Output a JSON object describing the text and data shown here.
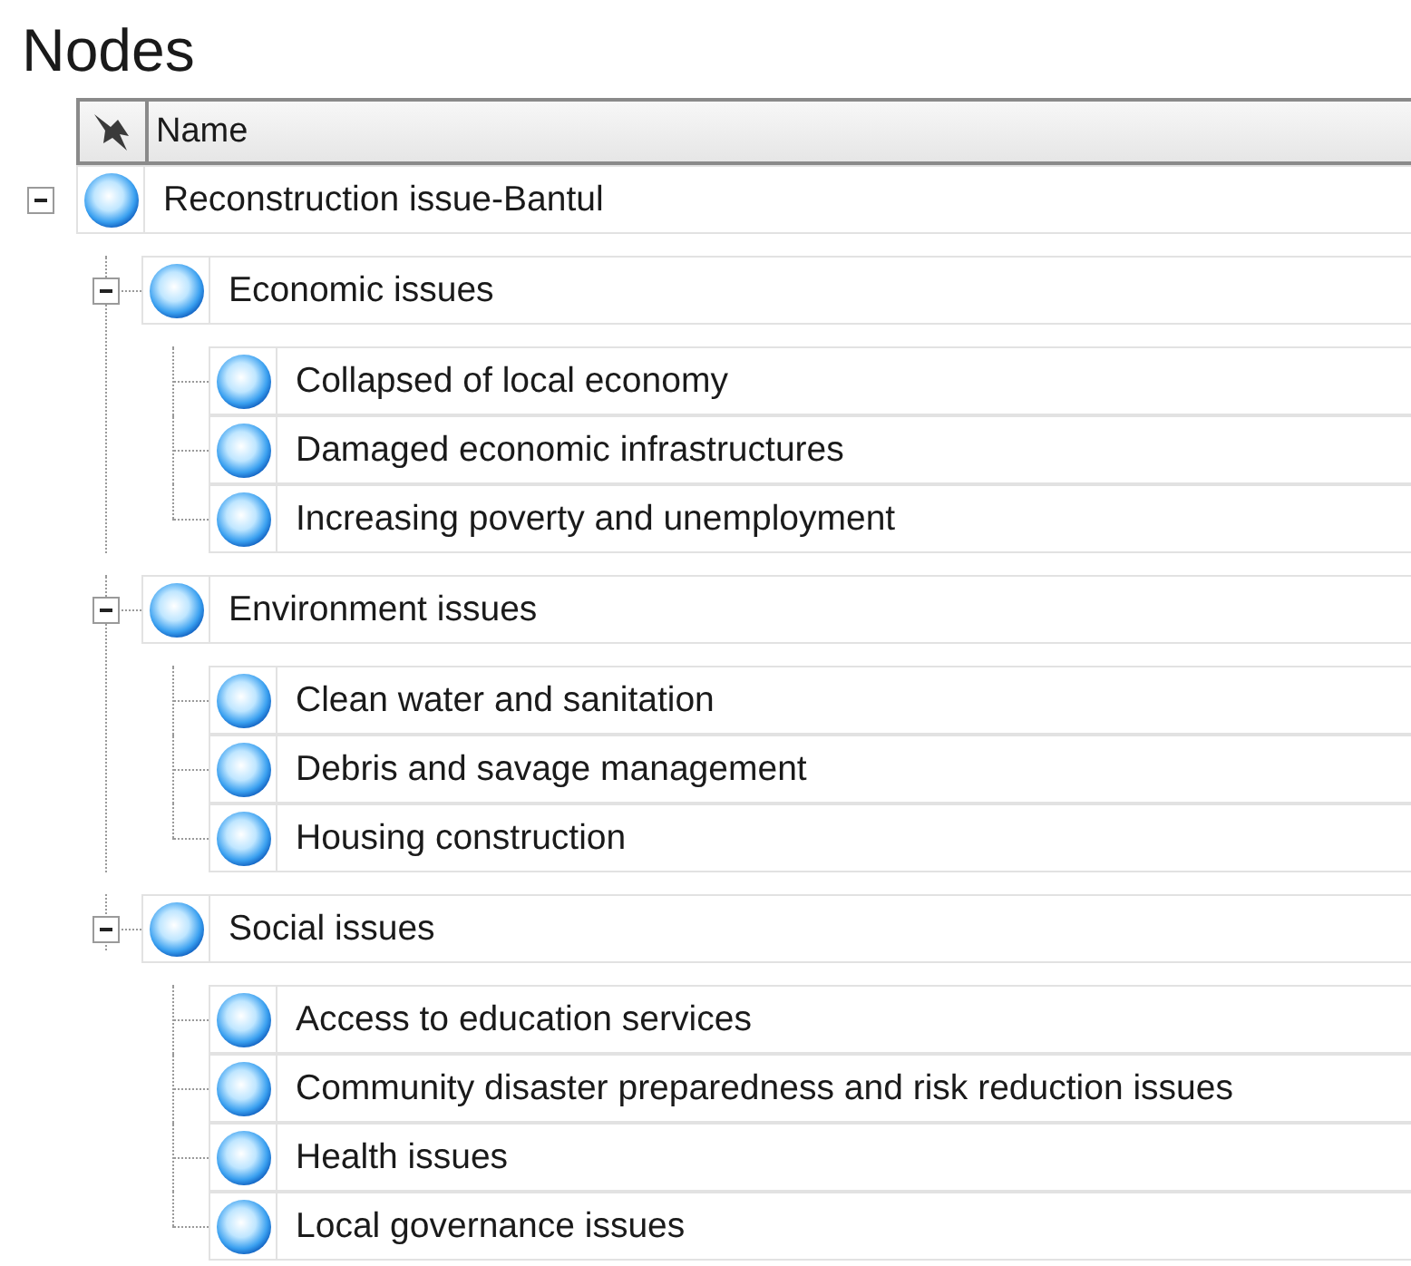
{
  "title": "Nodes",
  "columns": [
    "Name"
  ],
  "tree": [
    {
      "label": "Reconstruction issue-Bantul",
      "expanded": true,
      "children": [
        {
          "label": "Economic issues",
          "expanded": true,
          "children": [
            {
              "label": "Collapsed of local economy"
            },
            {
              "label": "Damaged economic infrastructures"
            },
            {
              "label": "Increasing poverty and unemployment"
            }
          ]
        },
        {
          "label": "Environment issues",
          "expanded": true,
          "children": [
            {
              "label": "Clean water and sanitation"
            },
            {
              "label": "Debris and savage management"
            },
            {
              "label": "Housing construction"
            }
          ]
        },
        {
          "label": "Social issues",
          "expanded": true,
          "children": [
            {
              "label": "Access to education services"
            },
            {
              "label": "Community disaster preparedness and risk reduction issues"
            },
            {
              "label": "Health issues"
            },
            {
              "label": "Local governance issues"
            }
          ]
        }
      ]
    }
  ]
}
